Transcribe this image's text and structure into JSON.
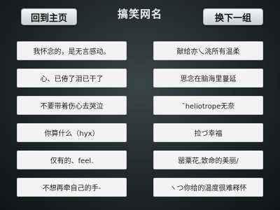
{
  "header": {
    "home_button": "回到主页",
    "title": "搞笑网名",
    "next_button": "换下一组"
  },
  "names": {
    "left": [
      "我怀念的，是无言感动。",
      "心、已倦了泪已干了",
      "不要带着伤心去哭泣",
      "你算什么（hyx）",
      "仅有的、feel.",
      "不想再牵自己的手-"
    ],
    "right": [
      "献给亦乀洮所有温柔",
      "思念在脑海里蔓延",
      "ˇheliotrope无奈",
      "捡づ幸福",
      "罂粟花,致命的美丽/",
      "ヽつ你给的温度很难释怀"
    ]
  }
}
